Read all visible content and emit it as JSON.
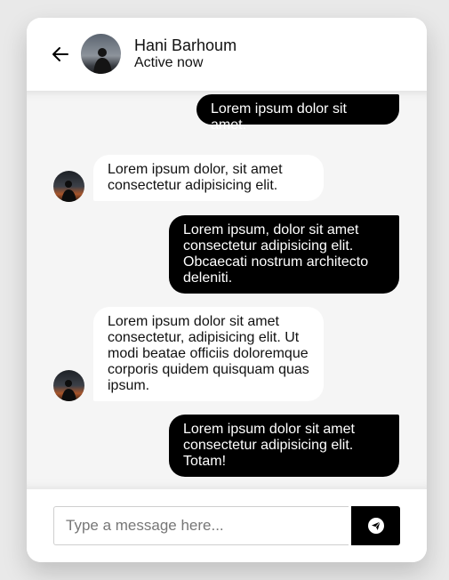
{
  "contact": {
    "name": "Hani Barhoum",
    "status": "Active now"
  },
  "icons": {
    "back": "arrow-left-icon",
    "send": "paper-plane-icon"
  },
  "messages": [
    {
      "direction": "outgoing",
      "text": "Lorem ipsum dolor sit amet."
    },
    {
      "direction": "incoming",
      "text": "Lorem ipsum dolor, sit amet consectetur adipisicing elit."
    },
    {
      "direction": "outgoing",
      "text": "Lorem ipsum, dolor sit amet consectetur adipisicing elit. Obcaecati nostrum architecto deleniti."
    },
    {
      "direction": "incoming",
      "text": "Lorem ipsum dolor sit amet consectetur, adipisicing elit. Ut modi beatae officiis doloremque corporis quidem quisquam quas ipsum."
    },
    {
      "direction": "outgoing",
      "text": "Lorem ipsum dolor sit amet consectetur adipisicing elit. Totam!"
    }
  ],
  "composer": {
    "placeholder": "Type a message here...",
    "value": ""
  },
  "colors": {
    "outgoing_bubble": "#000000",
    "incoming_bubble": "#ffffff",
    "chat_background": "#f5f5f5",
    "page_background": "#e9e9e9"
  }
}
